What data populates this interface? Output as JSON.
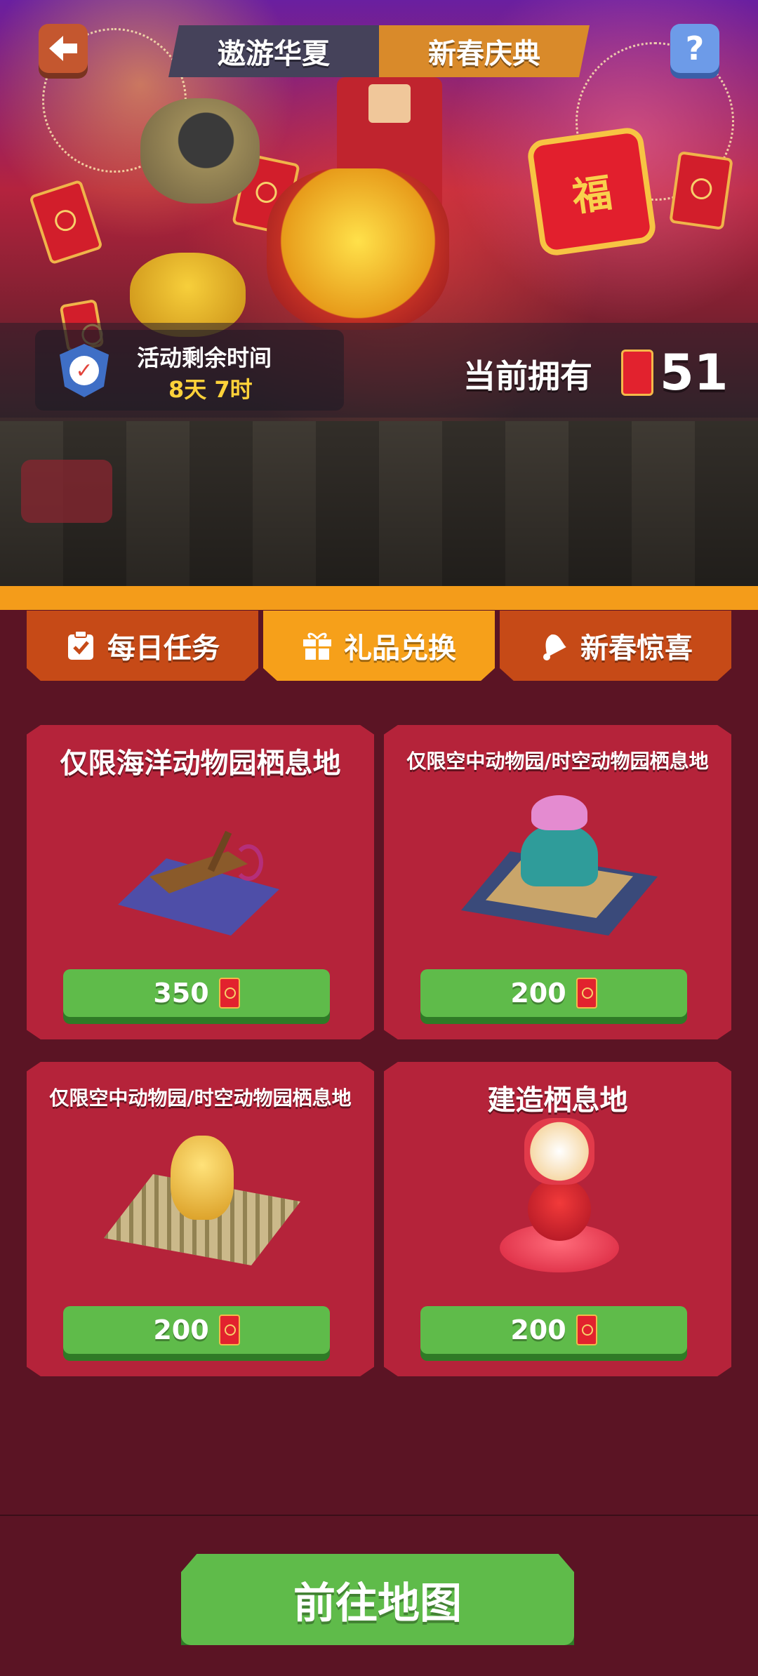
{
  "header": {
    "tabs": [
      "遨游华夏",
      "新春庆典"
    ],
    "active_tab": 1
  },
  "banner": {
    "timer_label": "活动剩余时间",
    "timer_value": "8天 7时",
    "owned_label": "当前拥有",
    "owned_count": "51",
    "fu_char": "福"
  },
  "tabs": [
    {
      "label": "每日任务",
      "icon": "clipboard-check-icon"
    },
    {
      "label": "礼品兑换",
      "icon": "gift-icon"
    },
    {
      "label": "新春惊喜",
      "icon": "bell-icon"
    }
  ],
  "active_tab": 1,
  "items": [
    {
      "title": "仅限海洋动物园栖息地",
      "price": "350"
    },
    {
      "title": "仅限空中动物园/时空动物园栖息地",
      "price": "200"
    },
    {
      "title": "仅限空中动物园/时空动物园栖息地",
      "price": "200"
    },
    {
      "title": "建造栖息地",
      "price": "200"
    }
  ],
  "go_button": "前往地图",
  "colors": {
    "panel_bg": "#5b1424",
    "card_bg": "#b5233a",
    "tab_active": "#f6a01a",
    "tab_inactive": "#c64a17",
    "button_green": "#5fbb4a",
    "timer_value": "#ffd23a"
  }
}
